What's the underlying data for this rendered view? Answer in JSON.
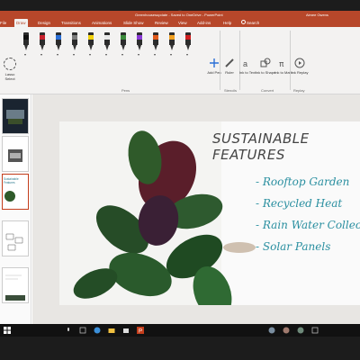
{
  "window": {
    "title": "Greenhousesupdate - Saved to OneDrive - PowerPoint",
    "user": "Aimee Owens"
  },
  "tabs": [
    {
      "label": "File"
    },
    {
      "label": "Draw",
      "active": true
    },
    {
      "label": "Design"
    },
    {
      "label": "Transitions"
    },
    {
      "label": "Animations"
    },
    {
      "label": "Slide Show"
    },
    {
      "label": "Review"
    },
    {
      "label": "View"
    },
    {
      "label": "Add-ins"
    },
    {
      "label": "Help"
    }
  ],
  "search_label": "Search",
  "ribbon": {
    "lasso_label": "Lasso Select",
    "pen_colors": [
      "#111111",
      "#c8202c",
      "#2b6fd6",
      "#7a7a7a",
      "#f1d20c",
      "#e8e8e8",
      "#3a8a3a",
      "#8a3ad6",
      "#e05a1b",
      "#f0a020",
      "#d02020"
    ],
    "add_pen_label": "Add Pen",
    "ruler_label": "Ruler",
    "ink_to_text_label": "Ink to Text",
    "ink_to_shape_label": "Ink to Shape",
    "ink_to_math_label": "Ink to Math",
    "ink_replay_label": "Ink Replay",
    "groups": [
      "Pens",
      "Stencils",
      "Convert",
      "Replay"
    ]
  },
  "slides_pane": {
    "thumb3_text": "Sustainable Features"
  },
  "slide": {
    "title": "SUSTAINABLE FEATURES",
    "bullets": [
      "- Rooftop Garden",
      "- Recycled Heat",
      "- Rain Water Collection",
      "- Solar Panels"
    ]
  }
}
